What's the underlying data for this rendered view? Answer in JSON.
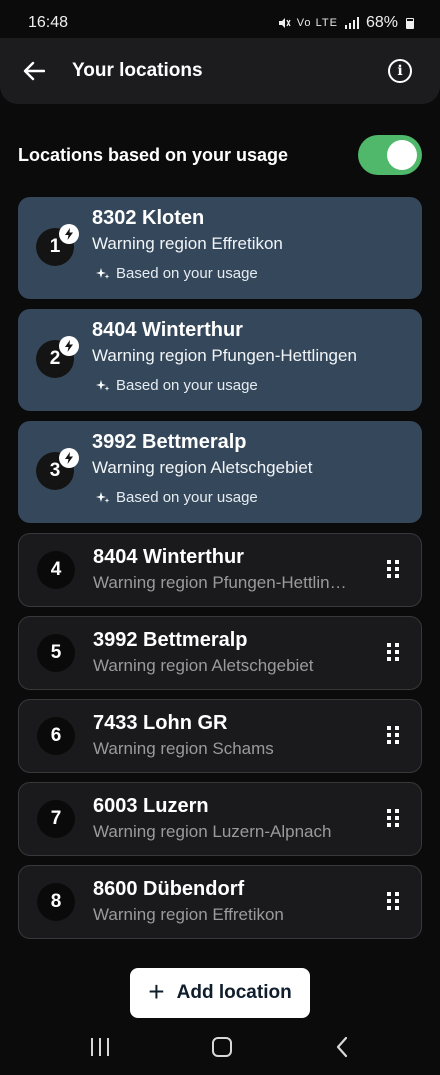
{
  "status_bar": {
    "time": "16:48",
    "icons": "Vo LTE",
    "battery": "68%"
  },
  "header": {
    "title": "Your locations"
  },
  "usage": {
    "label": "Locations based on your usage",
    "toggle_on": true
  },
  "auto_locations": [
    {
      "number": "1",
      "title": "8302 Kloten",
      "region": "Warning region Effretikon",
      "based_label": "Based on your usage"
    },
    {
      "number": "2",
      "title": "8404 Winterthur",
      "region": "Warning region Pfungen-Hettlingen",
      "based_label": "Based on your usage"
    },
    {
      "number": "3",
      "title": "3992 Bettmeralp",
      "region": "Warning region Aletschgebiet",
      "based_label": "Based on your usage"
    }
  ],
  "saved_locations": [
    {
      "number": "4",
      "title": "8404 Winterthur",
      "region": "Warning region Pfungen-Hettlingen"
    },
    {
      "number": "5",
      "title": "3992 Bettmeralp",
      "region": "Warning region Aletschgebiet"
    },
    {
      "number": "6",
      "title": "7433 Lohn GR",
      "region": "Warning region Schams"
    },
    {
      "number": "7",
      "title": "6003 Luzern",
      "region": "Warning region Luzern-Alpnach"
    },
    {
      "number": "8",
      "title": "8600 Dübendorf",
      "region": "Warning region Effretikon"
    }
  ],
  "add_button": {
    "label": "Add location"
  },
  "colors": {
    "auto_card": "#35485b",
    "toggle": "#4fb86a",
    "background": "#0b0b0c"
  }
}
